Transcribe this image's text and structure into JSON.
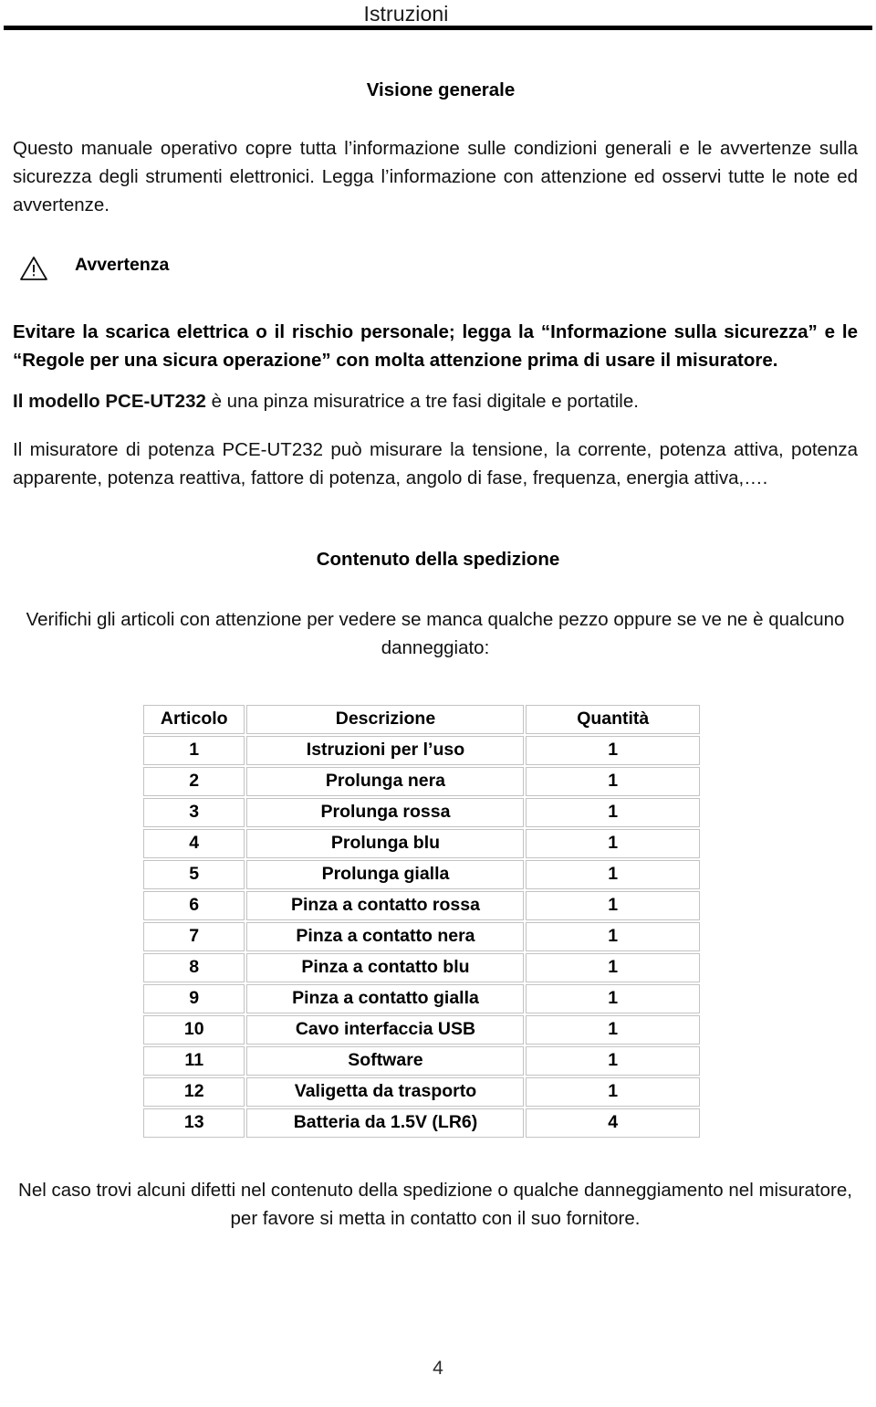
{
  "header": {
    "title": "Istruzioni"
  },
  "overview": {
    "heading": "Visione generale",
    "paragraph": "Questo manuale operativo copre tutta l’informazione sulle condizioni generali e le avvertenze sulla sicurezza degli strumenti elettronici. Legga l’informazione con attenzione ed osservi tutte le note ed avvertenze."
  },
  "warning": {
    "icon": "warning-triangle-icon",
    "label": "Avvertenza",
    "bold_text": "Evitare la scarica elettrica o il rischio personale; legga la “Informazione sulla sicurezza” e le “Regole per una sicura operazione” con molta attenzione prima di usare il misuratore.",
    "model_lead": "Il modello PCE-UT232",
    "model_rest": " è una pinza misuratrice a tre fasi digitale e portatile.",
    "description": "Il misuratore di potenza PCE-UT232 può misurare la tensione, la corrente, potenza attiva, potenza apparente, potenza reattiva, fattore di potenza, angolo di fase, frequenza, energia attiva,…."
  },
  "shipment": {
    "heading": "Contenuto della spedizione",
    "intro": "Verifichi gli articoli con attenzione per vedere se manca qualche pezzo oppure se ve ne è qualcuno danneggiato:",
    "columns": [
      "Articolo",
      "Descrizione",
      "Quantità"
    ],
    "rows": [
      [
        "1",
        "Istruzioni per l’uso",
        "1"
      ],
      [
        "2",
        "Prolunga nera",
        "1"
      ],
      [
        "3",
        "Prolunga rossa",
        "1"
      ],
      [
        "4",
        "Prolunga blu",
        "1"
      ],
      [
        "5",
        "Prolunga gialla",
        "1"
      ],
      [
        "6",
        "Pinza a contatto rossa",
        "1"
      ],
      [
        "7",
        "Pinza a contatto nera",
        "1"
      ],
      [
        "8",
        "Pinza a contatto blu",
        "1"
      ],
      [
        "9",
        "Pinza a contatto gialla",
        "1"
      ],
      [
        "10",
        "Cavo interfaccia USB",
        "1"
      ],
      [
        "11",
        "Software",
        "1"
      ],
      [
        "12",
        "Valigetta da trasporto",
        "1"
      ],
      [
        "13",
        "Batteria da 1.5V (LR6)",
        "4"
      ]
    ],
    "closing": "Nel caso trovi alcuni difetti nel contenuto della spedizione o qualche danneggiamento nel misuratore, per favore si metta in contatto con il suo fornitore."
  },
  "footer": {
    "page_number": "4"
  }
}
